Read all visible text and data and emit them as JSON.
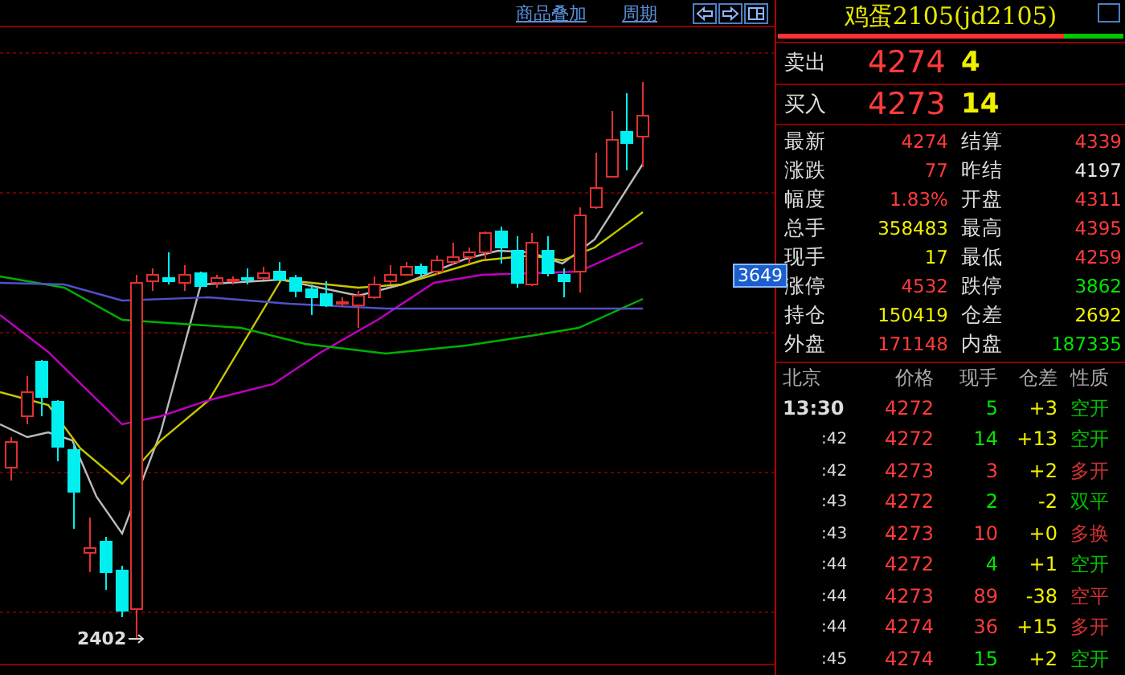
{
  "toolbar": {
    "links": [
      "商品叠加",
      "周期"
    ]
  },
  "chart": {
    "price_tag": "3649",
    "low_label": "2402"
  },
  "quote": {
    "title": "鸡蛋2105(jd2105)",
    "ratio_bar": {
      "level": 0.83
    },
    "sell": {
      "label": "卖出",
      "price": "4274",
      "volume": "4"
    },
    "buy": {
      "label": "买入",
      "price": "4273",
      "volume": "14"
    },
    "stats": [
      {
        "label": "最新",
        "value": "4274",
        "kind": "up"
      },
      {
        "label": "结算",
        "value": "4339",
        "kind": "up"
      },
      {
        "label": "涨跌",
        "value": "77",
        "kind": "up"
      },
      {
        "label": "昨结",
        "value": "4197",
        "kind": "flat"
      },
      {
        "label": "幅度",
        "value": "1.83%",
        "kind": "up"
      },
      {
        "label": "开盘",
        "value": "4311",
        "kind": "up"
      },
      {
        "label": "总手",
        "value": "358483",
        "kind": "volume"
      },
      {
        "label": "最高",
        "value": "4395",
        "kind": "up"
      },
      {
        "label": "现手",
        "value": "17",
        "kind": "volume"
      },
      {
        "label": "最低",
        "value": "4259",
        "kind": "up"
      },
      {
        "label": "涨停",
        "value": "4532",
        "kind": "up"
      },
      {
        "label": "跌停",
        "value": "3862",
        "kind": "down"
      },
      {
        "label": "持仓",
        "value": "150419",
        "kind": "volume"
      },
      {
        "label": "仓差",
        "value": "2692",
        "kind": "volume"
      },
      {
        "label": "外盘",
        "value": "171148",
        "kind": "up"
      },
      {
        "label": "内盘",
        "value": "187335",
        "kind": "down"
      }
    ]
  },
  "trades": {
    "columns": [
      "北京",
      "价格",
      "现手",
      "仓差",
      "性质"
    ],
    "rows": [
      {
        "time": "13:30",
        "price": "4272",
        "volume": "5",
        "change": "+3",
        "nature": "空开",
        "kind": "down"
      },
      {
        "time": ":42",
        "price": "4272",
        "volume": "14",
        "change": "+13",
        "nature": "空开",
        "kind": "down"
      },
      {
        "time": ":42",
        "price": "4273",
        "volume": "3",
        "change": "+2",
        "nature": "多开",
        "kind": "up"
      },
      {
        "time": ":43",
        "price": "4272",
        "volume": "2",
        "change": "-2",
        "nature": "双平",
        "kind": "down"
      },
      {
        "time": ":43",
        "price": "4273",
        "volume": "10",
        "change": "+0",
        "nature": "多换",
        "kind": "up"
      },
      {
        "time": ":44",
        "price": "4272",
        "volume": "4",
        "change": "+1",
        "nature": "空开",
        "kind": "down"
      },
      {
        "time": ":44",
        "price": "4273",
        "volume": "89",
        "change": "-38",
        "nature": "空平",
        "kind": "up"
      },
      {
        "time": ":44",
        "price": "4274",
        "volume": "36",
        "change": "+15",
        "nature": "多开",
        "kind": "up"
      },
      {
        "time": ":45",
        "price": "4274",
        "volume": "15",
        "change": "+2",
        "nature": "空开",
        "kind": "down"
      }
    ]
  }
}
